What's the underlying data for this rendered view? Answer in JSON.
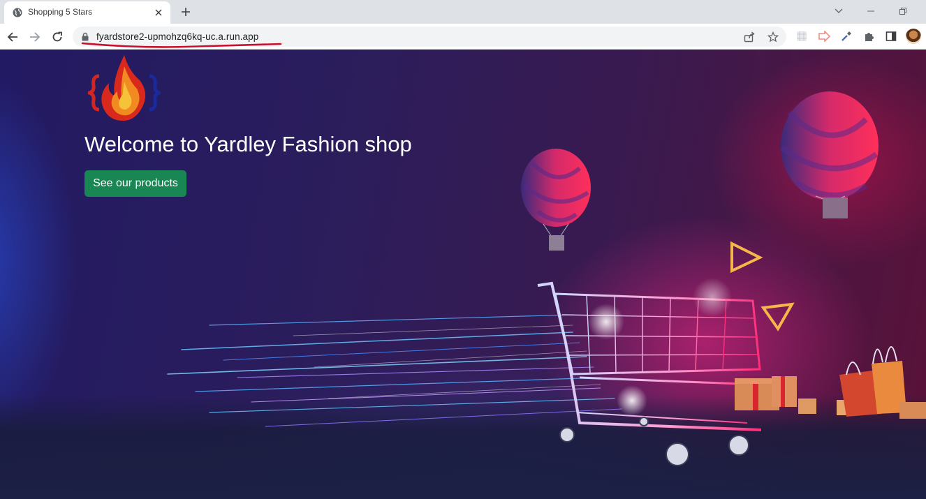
{
  "browser": {
    "tab": {
      "title": "Shopping 5 Stars"
    },
    "address_bar": {
      "url": "fyardstore2-upmohzq6kq-uc.a.run.app"
    }
  },
  "page": {
    "heading": "Welcome to Yardley Fashion shop",
    "cta_label": "See our products"
  },
  "colors": {
    "cta_bg": "#198754",
    "annotation_underline": "#c8102e"
  }
}
